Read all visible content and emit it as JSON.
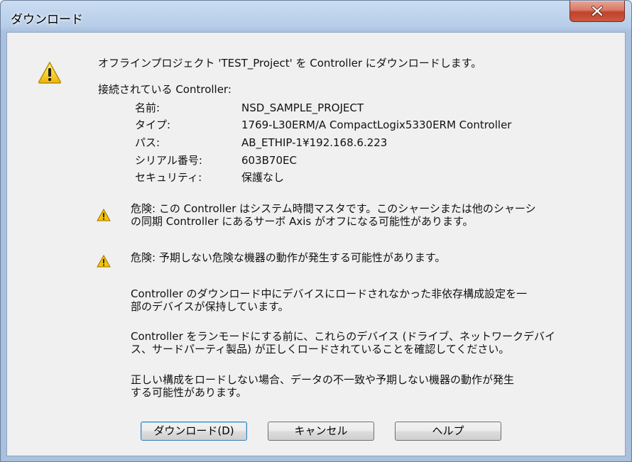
{
  "window": {
    "title": "ダウンロード"
  },
  "message": {
    "intro": "オフラインプロジェクト 'TEST_Project' を Controller にダウンロードします。",
    "connected_label": "接続されている Controller:",
    "details": [
      {
        "label": "名前:",
        "value": "NSD_SAMPLE_PROJECT"
      },
      {
        "label": "タイプ:",
        "value": "1769-L30ERM/A CompactLogix5330ERM Controller"
      },
      {
        "label": "パス:",
        "value": "AB_ETHIP-1¥192.168.6.223"
      },
      {
        "label": "シリアル番号:",
        "value": "603B70EC"
      },
      {
        "label": "セキュリティ:",
        "value": "保護なし"
      }
    ],
    "danger1": {
      "line1": "危険: この Controller はシステム時間マスタです。このシャーシまたは他のシャーシ",
      "line2": "の同期 Controller にあるサーボ Axis がオフになる可能性があります。"
    },
    "danger2": {
      "line1": "危険: 予期しない危険な機器の動作が発生する可能性があります。"
    },
    "para1": {
      "line1": "Controller のダウンロード中にデバイスにロードされなかった非依存構成設定を一",
      "line2": "部のデバイスが保持しています。"
    },
    "para2": {
      "line1": "Controller をランモードにする前に、これらのデバイス (ドライブ、ネットワークデバイ",
      "line2": "ス、サードパーティ製品) が正しくロードされていることを確認してください。"
    },
    "para3": {
      "line1": "正しい構成をロードしない場合、データの不一致や予期しない機器の動作が発生",
      "line2": "する可能性があります。"
    }
  },
  "buttons": {
    "download": "ダウンロード(D)",
    "cancel": "キャンセル",
    "help": "ヘルプ"
  },
  "icons": {
    "warning": "warning-icon",
    "close": "close-icon"
  },
  "colors": {
    "warning_yellow": "#f5c400",
    "close_red": "#c1432c"
  }
}
